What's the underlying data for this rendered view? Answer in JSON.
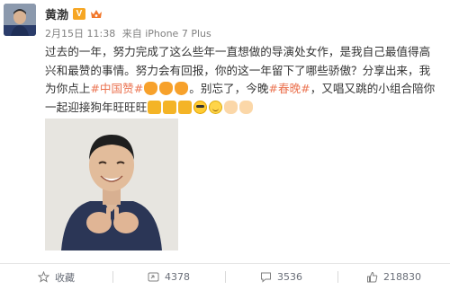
{
  "post": {
    "author": "黄渤",
    "verified_badge": "V",
    "date": "2月15日 11:38",
    "source": "来自 iPhone 7 Plus",
    "text": {
      "part1": "过去的一年，努力完成了这么些年一直想做的导演处女作，是我自己最值得高兴和最赞的事情。努力会有回报，你的这一年留下了哪些骄傲？分享出来，我为你点上",
      "tag1": "#中国赞#",
      "part2": "。别忘了，今晚",
      "tag2": "#春晚#",
      "part3": "，又唱又跳的小组合陪你一起迎接狗年旺旺旺"
    }
  },
  "actions": {
    "favorite": "收藏",
    "repost": "4378",
    "comment": "3536",
    "like": "218830"
  },
  "colors": {
    "topic_link": "#eb7350",
    "meta_text": "#808080",
    "action_text": "#696e78"
  }
}
